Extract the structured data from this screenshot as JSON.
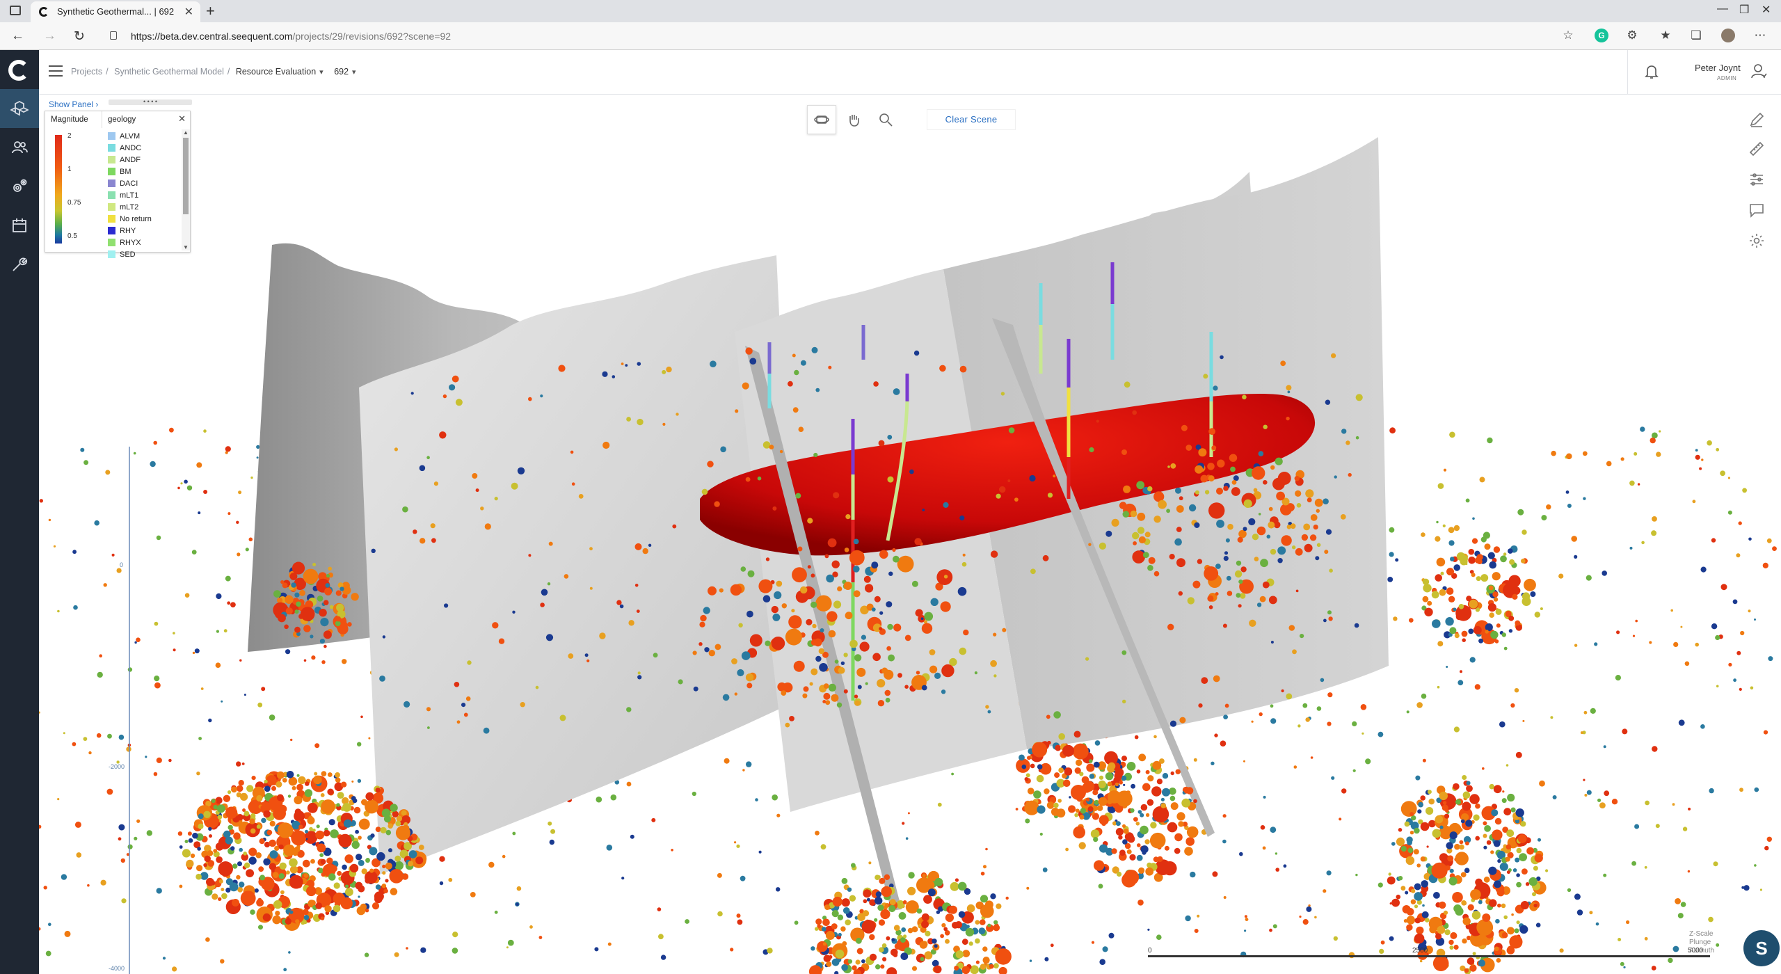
{
  "browser": {
    "tab_title": "Synthetic Geothermal... | 692",
    "url_host": "https://beta.dev.central.seequent.com",
    "url_path": "/projects/29/revisions/692?scene=92"
  },
  "breadcrumb": {
    "projects": "Projects",
    "project": "Synthetic Geothermal Model",
    "section": "Resource Evaluation",
    "revision": "692"
  },
  "user": {
    "name": "Peter Joynt",
    "role": "ADMIN"
  },
  "panel": {
    "show_panel": "Show Panel",
    "grip": "• • • •",
    "magnitude_tab": "Magnitude",
    "geology_tab": "geology",
    "magnitude_labels": [
      "2",
      "1",
      "0.75",
      "0.5"
    ],
    "geology_items": [
      {
        "label": "ALVM",
        "color": "#9ec8f0"
      },
      {
        "label": "ANDC",
        "color": "#7adce0"
      },
      {
        "label": "ANDF",
        "color": "#c8e890"
      },
      {
        "label": "BM",
        "color": "#7ed860"
      },
      {
        "label": "DACI",
        "color": "#8a86d0"
      },
      {
        "label": "mLT1",
        "color": "#8ae0b0"
      },
      {
        "label": "mLT2",
        "color": "#d0e880"
      },
      {
        "label": "No return",
        "color": "#f0e040"
      },
      {
        "label": "RHY",
        "color": "#2a2ad0"
      },
      {
        "label": "RHYX",
        "color": "#90e070"
      },
      {
        "label": "SED",
        "color": "#a0f0f0"
      }
    ]
  },
  "toolbar": {
    "clear_scene": "Clear Scene"
  },
  "axis": {
    "tick_top": "0",
    "tick_mid": "-2000",
    "tick_bottom": "-4000"
  },
  "scale": {
    "start": "0",
    "mid": "2500",
    "end": "5000"
  },
  "orientation": {
    "line1": "Z-Scale",
    "line2": "Plunge",
    "line3": "Azimuth"
  },
  "assistant": {
    "letter": "S"
  }
}
